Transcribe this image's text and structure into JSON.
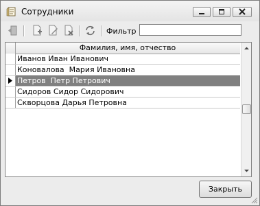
{
  "window": {
    "title": "Сотрудники"
  },
  "toolbar": {
    "icons": [
      "exit-icon",
      "add-record-icon",
      "edit-record-icon",
      "delete-record-icon",
      "refresh-icon"
    ],
    "filter_label": "Фильтр",
    "filter_value": ""
  },
  "grid": {
    "column_header": "Фамилия, имя, отчество",
    "rows": [
      "Иванов Иван Иванович",
      "Коновалова  Мария Ивановна",
      "Петров  Петр Петрович",
      "Сидоров Сидор Сидорович",
      "Скворцова Дарья Петровна"
    ],
    "selected_row": 2
  },
  "footer": {
    "close_label": "Закрыть"
  },
  "colors": {
    "selection": "#808080",
    "window_bg": "#ececec"
  }
}
